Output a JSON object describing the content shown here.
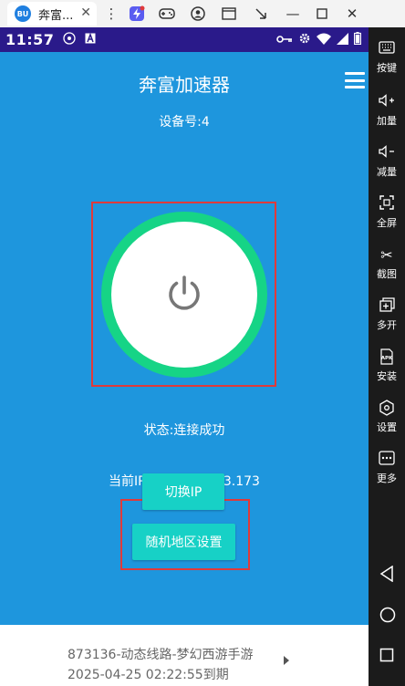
{
  "window": {
    "tab_title": "奔富...",
    "tab_logo": "BU"
  },
  "statusbar": {
    "time": "11:57"
  },
  "app": {
    "title": "奔富加速器",
    "device": "设备号:4",
    "status": "状态:连接成功",
    "ip": "当前IP：60.219.253.173",
    "switch_ip_label": "切换IP",
    "random_region_label": "随机地区设置",
    "line_name": "873136-动态线路-梦幻西游手游",
    "expire": "2025-04-25 02:22:55到期"
  },
  "side_panel": {
    "items": [
      {
        "label": "按键",
        "icon": "keyboard-icon"
      },
      {
        "label": "加量",
        "icon": "volume-up-icon"
      },
      {
        "label": "减量",
        "icon": "volume-down-icon"
      },
      {
        "label": "全屏",
        "icon": "fullscreen-icon"
      },
      {
        "label": "截图",
        "icon": "scissors-icon"
      },
      {
        "label": "多开",
        "icon": "multi-window-icon"
      },
      {
        "label": "安装",
        "icon": "apk-icon"
      },
      {
        "label": "设置",
        "icon": "settings-icon"
      },
      {
        "label": "更多",
        "icon": "more-icon"
      }
    ]
  },
  "colors": {
    "app_bg": "#1e96dd",
    "ring": "#16d486",
    "button": "#17d1c6",
    "highlight": "#e03a3a",
    "statusbar": "#2a1a8a"
  }
}
